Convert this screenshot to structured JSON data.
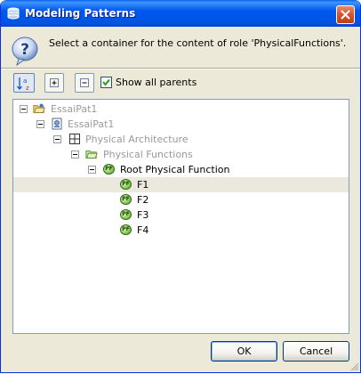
{
  "window": {
    "title": "Modeling Patterns"
  },
  "message": "Select a container for the content of role 'PhysicalFunctions'.",
  "toolbar": {
    "show_all_parents_label": "Show all parents",
    "show_all_parents_checked": true
  },
  "tree": {
    "nodes": [
      {
        "label": "EssaiPat1",
        "depth": 0,
        "type": "project",
        "enabled": false,
        "expanded": true
      },
      {
        "label": "EssaiPat1",
        "depth": 1,
        "type": "model",
        "enabled": false,
        "expanded": true
      },
      {
        "label": "Physical Architecture",
        "depth": 2,
        "type": "architecture",
        "enabled": false,
        "expanded": true
      },
      {
        "label": "Physical Functions",
        "depth": 3,
        "type": "folder",
        "enabled": false,
        "expanded": true
      },
      {
        "label": "Root Physical Function",
        "depth": 4,
        "type": "function",
        "enabled": true,
        "expanded": true
      },
      {
        "label": "F1",
        "depth": 5,
        "type": "function",
        "enabled": true,
        "selected": true
      },
      {
        "label": "F2",
        "depth": 5,
        "type": "function",
        "enabled": true
      },
      {
        "label": "F3",
        "depth": 5,
        "type": "function",
        "enabled": true
      },
      {
        "label": "F4",
        "depth": 5,
        "type": "function",
        "enabled": true
      }
    ],
    "function_badge_text": "PF"
  },
  "buttons": {
    "ok": "OK",
    "cancel": "Cancel"
  }
}
